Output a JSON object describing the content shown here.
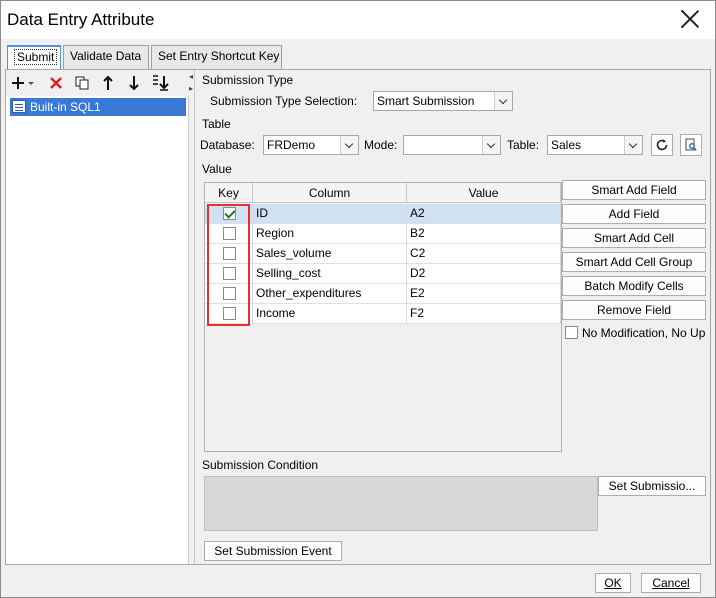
{
  "window": {
    "title": "Data Entry Attribute"
  },
  "tabs": [
    {
      "label": "Submit"
    },
    {
      "label": "Validate Data"
    },
    {
      "label": "Set Entry Shortcut Key"
    }
  ],
  "left_toolbar": {
    "icons": [
      "add-dropdown-icon",
      "delete-icon",
      "copy-icon",
      "move-up-icon",
      "move-down-icon",
      "move-bottom-icon"
    ]
  },
  "tree": {
    "items": [
      {
        "label": "Built-in SQL1",
        "icon": "database-icon",
        "selected": true
      }
    ]
  },
  "submission_type": {
    "section_label": "Submission Type",
    "selection_label": "Submission Type Selection:",
    "selection_value": "Smart Submission"
  },
  "table_section": {
    "section_label": "Table",
    "database_label": "Database:",
    "database_value": "FRDemo",
    "mode_label": "Mode:",
    "mode_value": "",
    "table_label": "Table:",
    "table_value": "Sales",
    "refresh_icon": "refresh-icon",
    "preview_icon": "preview-icon"
  },
  "value_section": {
    "section_label": "Value",
    "columns": [
      "Key",
      "Column",
      "Value"
    ],
    "rows": [
      {
        "key": true,
        "column": "ID",
        "value": "A2"
      },
      {
        "key": false,
        "column": "Region",
        "value": "B2"
      },
      {
        "key": false,
        "column": "Sales_volume",
        "value": "C2"
      },
      {
        "key": false,
        "column": "Selling_cost",
        "value": "D2"
      },
      {
        "key": false,
        "column": "Other_expenditures",
        "value": "E2"
      },
      {
        "key": false,
        "column": "Income",
        "value": "F2"
      }
    ],
    "buttons": [
      "Smart Add Field",
      "Add Field",
      "Smart Add Cell",
      "Smart Add Cell Group",
      "Batch Modify Cells",
      "Remove Field"
    ],
    "no_modification_label": "No Modification, No Up",
    "no_modification_checked": false
  },
  "submission_condition": {
    "section_label": "Submission Condition",
    "button_label": "Set Submissio..."
  },
  "submission_event": {
    "button_label": "Set Submission Event"
  },
  "footer": {
    "ok_label": "OK",
    "cancel_label": "Cancel"
  },
  "colors": {
    "selection_blue": "#3a78d6",
    "row_highlight": "#cfe1f3",
    "highlight_red": "#e53030",
    "check_green": "#1a7b2a"
  }
}
